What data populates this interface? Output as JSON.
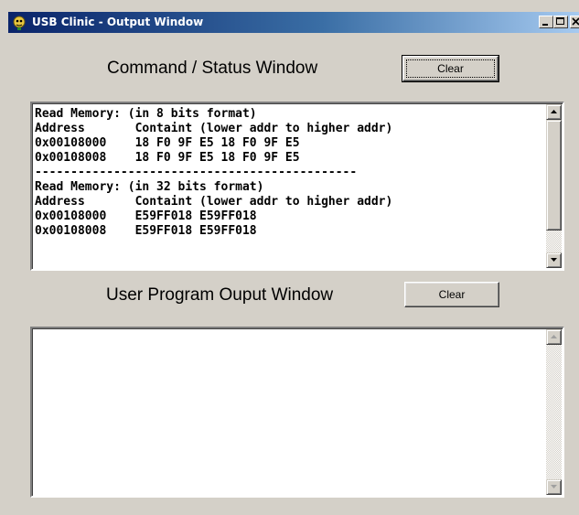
{
  "window": {
    "title": "USB Clinic - Output Window",
    "icon": "usb-clinic-app-icon",
    "controls": [
      "minimize-icon",
      "maximize-icon",
      "close-icon"
    ]
  },
  "command_status": {
    "heading": "Command / Status Window",
    "clear_label": "Clear",
    "lines": [
      "Read Memory: (in 8 bits format)",
      "Address       Containt (lower addr to higher addr)",
      "0x00108000    18 F0 9F E5 18 F0 9F E5",
      "0x00108008    18 F0 9F E5 18 F0 9F E5",
      "---------------------------------------------",
      "Read Memory: (in 32 bits format)",
      "Address       Containt (lower addr to higher addr)",
      "0x00108000    E59FF018 E59FF018",
      "0x00108008    E59FF018 E59FF018"
    ]
  },
  "user_program": {
    "heading": "User Program Ouput Window",
    "clear_label": "Clear",
    "content": ""
  }
}
